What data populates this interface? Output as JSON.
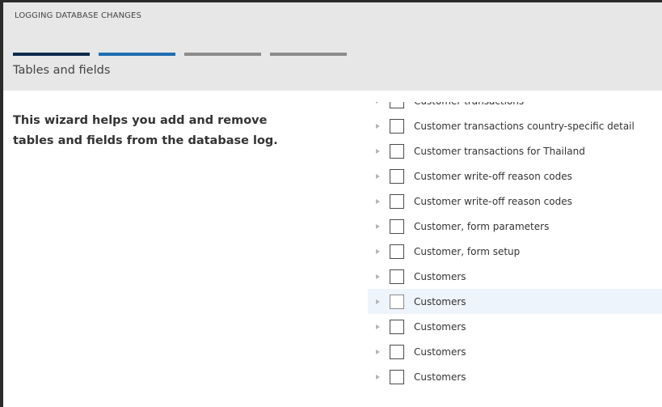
{
  "wizard": {
    "name": "LOGGING DATABASE CHANGES",
    "step_title": "Tables and fields",
    "step_colors": [
      "#0f2a4d",
      "#1f6fb2",
      "#8c8c8c",
      "#8c8c8c"
    ]
  },
  "intro": {
    "text": "This wizard helps you add and remove tables and fields from the database log."
  },
  "tree": {
    "rows": [
      {
        "label": "Customer transactions",
        "selected": false,
        "highlighted": false
      },
      {
        "label": "Customer transactions country-specific detail",
        "selected": false,
        "highlighted": false
      },
      {
        "label": "Customer transactions for Thailand",
        "selected": false,
        "highlighted": false
      },
      {
        "label": "Customer write-off reason codes",
        "selected": false,
        "highlighted": false
      },
      {
        "label": "Customer write-off reason codes",
        "selected": false,
        "highlighted": false
      },
      {
        "label": "Customer, form parameters",
        "selected": false,
        "highlighted": false
      },
      {
        "label": "Customer, form setup",
        "selected": false,
        "highlighted": false
      },
      {
        "label": "Customers",
        "selected": false,
        "highlighted": false
      },
      {
        "label": "Customers",
        "selected": false,
        "highlighted": true
      },
      {
        "label": "Customers",
        "selected": false,
        "highlighted": false
      },
      {
        "label": "Customers",
        "selected": false,
        "highlighted": false
      },
      {
        "label": "Customers",
        "selected": false,
        "highlighted": false
      }
    ]
  },
  "icons": {
    "expander": "chevron-right-icon",
    "checkbox": "checkbox-icon"
  }
}
